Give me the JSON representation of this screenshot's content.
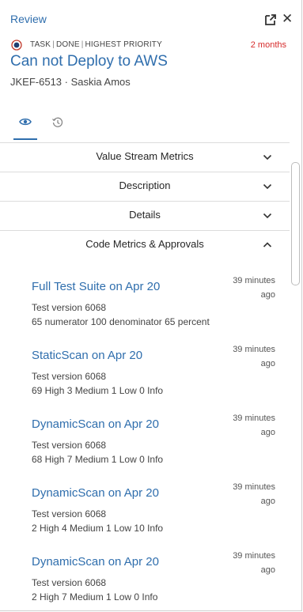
{
  "header": {
    "review_title": "Review",
    "meta": {
      "type": "TASK",
      "state": "DONE",
      "priority": "HIGHEST PRIORITY"
    },
    "age": "2 months",
    "task_title": "Can not Deploy to AWS",
    "task_key": "JKEF-6513",
    "separator": "·",
    "assignee": "Saskia Amos"
  },
  "tabs": [
    {
      "icon": "eye-icon",
      "active": true
    },
    {
      "icon": "history-icon",
      "active": false
    }
  ],
  "sections": [
    {
      "label": "Value Stream Metrics",
      "expanded": false
    },
    {
      "label": "Description",
      "expanded": false
    },
    {
      "label": "Details",
      "expanded": false
    },
    {
      "label": "Code Metrics & Approvals",
      "expanded": true
    }
  ],
  "items": [
    {
      "title": "Full Test Suite on Apr 20",
      "time_line1": "39 minutes",
      "time_line2": "ago",
      "version": "Test version 6068",
      "summary": "65 numerator 100 denominator 65 percent"
    },
    {
      "title": "StaticScan on Apr 20",
      "time_line1": "39 minutes",
      "time_line2": "ago",
      "version": "Test version 6068",
      "summary": "69 High 3 Medium 1 Low 0 Info"
    },
    {
      "title": "DynamicScan on Apr 20",
      "time_line1": "39 minutes",
      "time_line2": "ago",
      "version": "Test version 6068",
      "summary": "68 High 7 Medium 1 Low 0 Info"
    },
    {
      "title": "DynamicScan on Apr 20",
      "time_line1": "39 minutes",
      "time_line2": "ago",
      "version": "Test version 6068",
      "summary": "2 High 4 Medium 1 Low 10 Info"
    },
    {
      "title": "DynamicScan on Apr 20",
      "time_line1": "39 minutes",
      "time_line2": "ago",
      "version": "Test version 6068",
      "summary": "2 High 7 Medium 1 Low 0 Info"
    }
  ],
  "colors": {
    "accent": "#2f6ead",
    "alert": "#d62b2b",
    "status_ring": "#c0392b",
    "status_core": "#1d3f73"
  }
}
